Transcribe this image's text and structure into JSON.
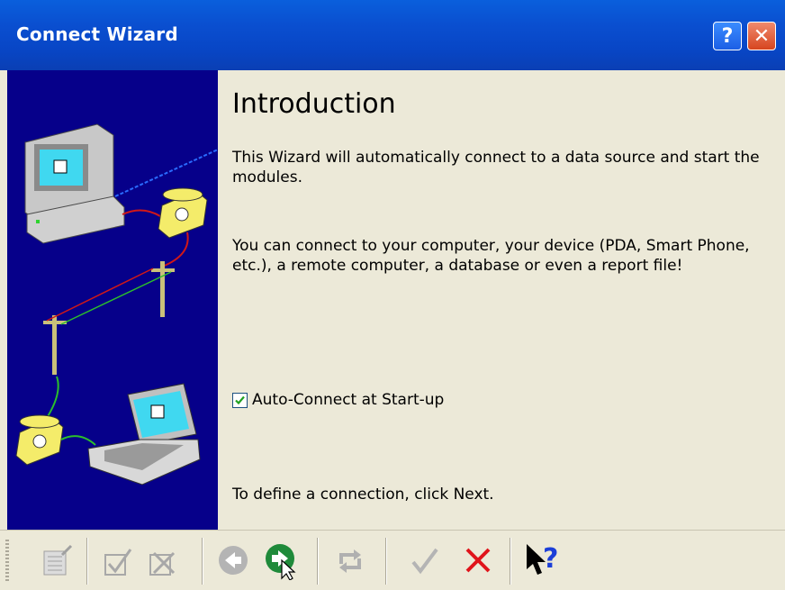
{
  "window": {
    "title": "Connect Wizard",
    "help_glyph": "?",
    "close_glyph": "✕"
  },
  "content": {
    "heading": "Introduction",
    "intro": "This Wizard will automatically connect to a data source and start the modules.",
    "options": "You can connect to your computer, your device (PDA, Smart Phone, etc.), a remote computer, a database or even a report file!",
    "autoconnect_label": "Auto-Connect at Start-up",
    "autoconnect_checked": true,
    "instruction": "To define a connection, click Next."
  },
  "illustration": {
    "icons": [
      "desktop-computer-icon",
      "telephone-icon",
      "utility-pole-icon",
      "telephone-icon",
      "laptop-icon"
    ]
  },
  "toolbar": {
    "buttons": [
      {
        "name": "properties-icon",
        "enabled": false
      },
      {
        "name": "edit-check-icon",
        "enabled": false
      },
      {
        "name": "edit-delete-icon",
        "enabled": false
      },
      {
        "name": "back-arrow-icon",
        "enabled": false
      },
      {
        "name": "next-arrow-icon",
        "enabled": true
      },
      {
        "name": "reload-icon",
        "enabled": false
      },
      {
        "name": "finish-check-icon",
        "enabled": false
      },
      {
        "name": "cancel-x-icon",
        "enabled": true
      },
      {
        "name": "whats-this-help-icon",
        "enabled": true
      }
    ]
  },
  "colors": {
    "titlebar": "#0a4fd0",
    "panel": "#06008a",
    "background": "#ece9d8",
    "next_green": "#1f8a3a",
    "cancel_red": "#e0141b"
  }
}
